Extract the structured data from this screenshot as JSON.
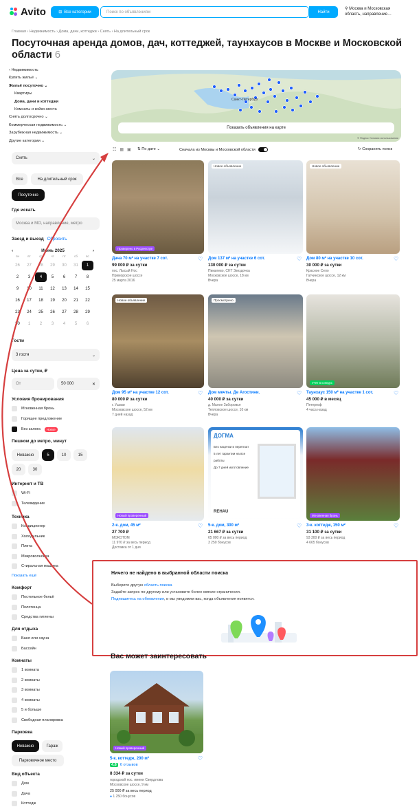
{
  "header": {
    "logo_text": "Avito",
    "categories_label": "Все категории",
    "search_placeholder": "Поиск по объявлениям",
    "find_label": "Найти",
    "location_line1": "Москва и Московская",
    "location_line2": "область, направление…"
  },
  "breadcrumb": "Главная › Недвижимость › Дома, дачи, коттеджи › Снять › На длительный срок",
  "page_title": "Посуточная аренда домов, дач, коттеджей, таунхаусов в Москве и Московской области",
  "page_count": "6",
  "sidebar": {
    "nav": [
      {
        "label": "‹ Недвижимость",
        "bold": false
      },
      {
        "label": "Купить жильё ⌄",
        "bold": false
      },
      {
        "label": "Жильё посуточно ⌄",
        "bold": true
      },
      {
        "label": "Квартиры",
        "bold": false,
        "indent": true
      },
      {
        "label": "Дома, дачи и коттеджи",
        "bold": true,
        "indent": true
      },
      {
        "label": "Комнаты и койко-места",
        "bold": false,
        "indent": true
      },
      {
        "label": "Снять долгосрочно ⌄",
        "bold": false
      },
      {
        "label": "Коммерческая недвижимость ⌄",
        "bold": false
      },
      {
        "label": "Зарубежная недвижимость ⌄",
        "bold": false
      },
      {
        "label": "Другие категории ⌄",
        "bold": false
      }
    ],
    "deal_select": "Снять",
    "term_chips": [
      "Все",
      "На длительный срок",
      "Посуточно"
    ],
    "where_heading": "Где искать",
    "where_value": "Москва и МО, направление, метро",
    "checkin_heading": "Заезд и выезд",
    "reset_label": "Сбросить",
    "month_label": "Июнь 2025",
    "weekdays": [
      "пн",
      "вт",
      "ср",
      "чт",
      "пт",
      "сб",
      "вс"
    ],
    "calendar_rows": [
      [
        "26",
        "27",
        "28",
        "29",
        "30",
        "31",
        "1"
      ],
      [
        "2",
        "3",
        "4",
        "5",
        "6",
        "7",
        "8"
      ],
      [
        "9",
        "10",
        "11",
        "12",
        "13",
        "14",
        "15"
      ],
      [
        "16",
        "17",
        "18",
        "19",
        "20",
        "21",
        "22"
      ],
      [
        "23",
        "24",
        "25",
        "26",
        "27",
        "28",
        "29"
      ],
      [
        "30",
        "1",
        "2",
        "3",
        "4",
        "5",
        "6"
      ]
    ],
    "guests_heading": "Гости",
    "guests_value": "3 гостя",
    "price_heading": "Цена за сутки, ₽",
    "price_from": "От",
    "price_to": "50 000",
    "booking_heading": "Условия бронирования",
    "booking": [
      "Мгновенная бронь",
      "Горящее предложение",
      "Без залога"
    ],
    "new_badge": "Новое",
    "metro_heading": "Пешком до метро, минут",
    "metro_chips": [
      "Неважно",
      "5",
      "10",
      "15",
      "20",
      "30"
    ],
    "internet_heading": "Интернет и ТВ",
    "internet": [
      "Wi-Fi",
      "Телевидение"
    ],
    "tech_heading": "Техника",
    "tech": [
      "Кондиционер",
      "Холодильник",
      "Плита",
      "Микроволновка",
      "Стиральная машина"
    ],
    "show_more": "Показать ещё",
    "comfort_heading": "Комфорт",
    "comfort": [
      "Постельное бельё",
      "Полотенца",
      "Средства гигиены"
    ],
    "rest_heading": "Для отдыха",
    "rest": [
      "Баня или сауна",
      "Бассейн"
    ],
    "rooms_heading": "Комнаты",
    "rooms": [
      "1 комната",
      "2 комнаты",
      "3 комнаты",
      "4 комнаты",
      "5 и больше",
      "Свободная планировка"
    ],
    "parking_heading": "Парковка",
    "parking_chips": [
      "Неважно",
      "Гараж",
      "Парковочное место"
    ],
    "objtype_heading": "Вид объекта",
    "objtype": [
      "Дом",
      "Дача",
      "Коттедж"
    ]
  },
  "map": {
    "show_label": "Показать объявления на карте",
    "city_label": "Санкт-Петербург",
    "copyright": "© Яндекс Условия использования"
  },
  "toolbar": {
    "sort_label": "По дате ⌄",
    "region_label": "Сначала из Москвы и Московской области",
    "save_label": "Сохранить поиск"
  },
  "listings": [
    {
      "title": "Дача 70 м² на участке 7 сот.",
      "price": "99 000 ₽ за сутки",
      "l1": "пос. Лысый Нос",
      "l2": "Приморское шоссе",
      "l3": "25 марта 2016",
      "badge": "",
      "pbadge": "Проверено в Росреестре",
      "pbadge_color": "purple"
    },
    {
      "title": "Дом 137 м² на участке 6 сот.",
      "price": "130 000 ₽ за сутки",
      "l1": "Пикалево, СНТ Звездочка",
      "l2": "Московское шоссе, 18 км",
      "l3": "Вчера",
      "badge": "Новое объявление",
      "pbadge": "",
      "pbadge_color": ""
    },
    {
      "title": "Дом 80 м² на участке 10 сот.",
      "price": "30 000 ₽ за сутки",
      "l1": "Красное Село",
      "l2": "Гатчинское шоссе, 12 км",
      "l3": "Вчера",
      "badge": "Новое объявление",
      "pbadge": "",
      "pbadge_color": ""
    },
    {
      "title": "Дом 95 м² на участке 12 сот.",
      "price": "80 000 ₽ за сутки",
      "l1": "г. Ушаки",
      "l2": "Московское шоссе, 52 км",
      "l3": "7 дней назад",
      "badge": "Новое объявление",
      "pbadge": "",
      "pbadge_color": ""
    },
    {
      "title": "Дом мечты. Де Агостини.",
      "price": "40 000 ₽ за сутки",
      "l1": "д. Малое Заборовье",
      "l2": "Тепловское шоссе, 10 км",
      "l3": "Вчера",
      "badge": "Просмотрено",
      "pbadge": "",
      "pbadge_color": ""
    },
    {
      "title": "Таунхаус 150 м² на участке 1 сот.",
      "price": "45 000 ₽ в месяц",
      "l1": "Петергоф",
      "l2": "4 часа назад",
      "l3": "",
      "badge": "",
      "pbadge": "Учёт в конкурс",
      "pbadge_color": "green"
    },
    {
      "title": "2-к. дом, 45 м²",
      "price": "27 700 ₽",
      "l1": "МОКОТОМ",
      "l2": "11 970 ₽ за весь период",
      "l3": "Доставка от 1 дня",
      "badge": "",
      "pbadge": "Новый проверенный",
      "pbadge_color": "purple"
    },
    {
      "title": "5-к. дом, 300 м²",
      "price": "21 667 ₽ за сутки",
      "l1": "65 000 ₽ за весь период",
      "l2": "3 250 бонусов",
      "l3": "",
      "badge": "",
      "pbadge": "",
      "pbadge_color": ""
    },
    {
      "title": "3-к. коттедж, 150 м²",
      "price": "31 100 ₽ за сутки",
      "l1": "93 300 ₽ за весь период",
      "l2": "4 665 бонусов",
      "l3": "",
      "badge": "",
      "pbadge": "Мгновенная бронь",
      "pbadge_color": "purple"
    }
  ],
  "promo": {
    "brand": "ДОГМА",
    "lines": [
      "Без наценки и переплат",
      "5 лет гарантии на все работы",
      "До 7 дней изготовление"
    ],
    "rehau": "REHAU"
  },
  "not_found": {
    "title": "Ничего не найдено в выбранной области поиска",
    "line1_prefix": "Выберите другую ",
    "line1_link": "область поиска",
    "line2": "Задайте запрос по-другому или установите более мягкие ограничения.",
    "line3_link": "Подпишитесь на обновления",
    "line3_rest": ", и мы уведомим вас, когда объявления появятся."
  },
  "recommend": {
    "heading": "Вас может заинтересовать",
    "badge": "Новый проверенный",
    "title": "5-к. коттедж, 200 м²",
    "rating": "4,8",
    "reviews": "6 отзывов",
    "price": "8 334 ₽ за сутки",
    "l1": "городской пос. имени Свердлова",
    "l2": "Московское шоссе, 9 км",
    "l3": "25 000 ₽ за весь период",
    "bonus": "1 250 бонусов"
  },
  "colors": {
    "accent": "#00aaff",
    "link": "#0077ff",
    "annotation": "#d63f3f"
  }
}
